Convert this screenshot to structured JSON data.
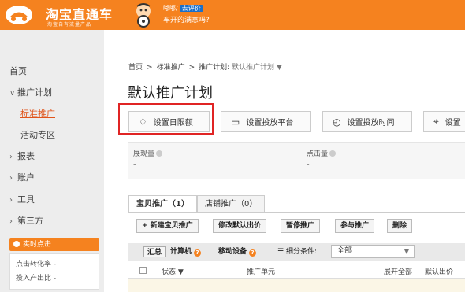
{
  "header": {
    "logo_title": "淘宝直通车",
    "logo_subtitle": "淘宝自有流量产品",
    "promo_prefix": "嘟嘟/",
    "promo_tag": "去评价",
    "promo_text": "车开的满意吗?"
  },
  "sidebar": {
    "items": [
      {
        "label": "首页",
        "chevron": ""
      },
      {
        "label": "推广计划",
        "chevron": "∨"
      },
      {
        "label": "标准推广",
        "chevron": ""
      },
      {
        "label": "活动专区",
        "chevron": ""
      },
      {
        "label": "报表",
        "chevron": "›"
      },
      {
        "label": "账户",
        "chevron": "›"
      },
      {
        "label": "工具",
        "chevron": "›"
      },
      {
        "label": "第三方",
        "chevron": "›"
      }
    ],
    "realtime_label": "实时点击",
    "metrics": [
      "点击转化率 -",
      "投入产出比 -"
    ]
  },
  "breadcrumb": {
    "home": "首页",
    "level2": "标准推广",
    "level3_prefix": "推广计划:",
    "level3_value": "默认推广计划",
    "caret": "▼"
  },
  "page_title": "默认推广计划",
  "toolbar": {
    "budget_label": "设置日限额",
    "platform_label": "设置投放平台",
    "time_label": "设置投放时间",
    "region_label": "设置"
  },
  "stats": {
    "impressions_label": "展现量",
    "impressions_value": "-",
    "clicks_label": "点击量",
    "clicks_value": "-"
  },
  "tabs": {
    "item_promo": "宝贝推广（1）",
    "shop_promo": "店铺推广（0）"
  },
  "actions": {
    "new_item": "+ 新建宝贝推广",
    "edit_bid": "修改默认出价",
    "pause": "暂停推广",
    "join": "参与推广",
    "delete": "删除"
  },
  "filter": {
    "summary": "汇总",
    "computer": "计算机",
    "mobile": "移动设备",
    "condition_label": "细分条件:",
    "condition_value": "全部"
  },
  "table": {
    "status_col": "状态 ▼",
    "unit_col": "推广单元",
    "expand_col": "展开全部",
    "bid_col": "默认出价"
  },
  "colors": {
    "brand": "#f5821f",
    "highlight": "#e02424"
  }
}
